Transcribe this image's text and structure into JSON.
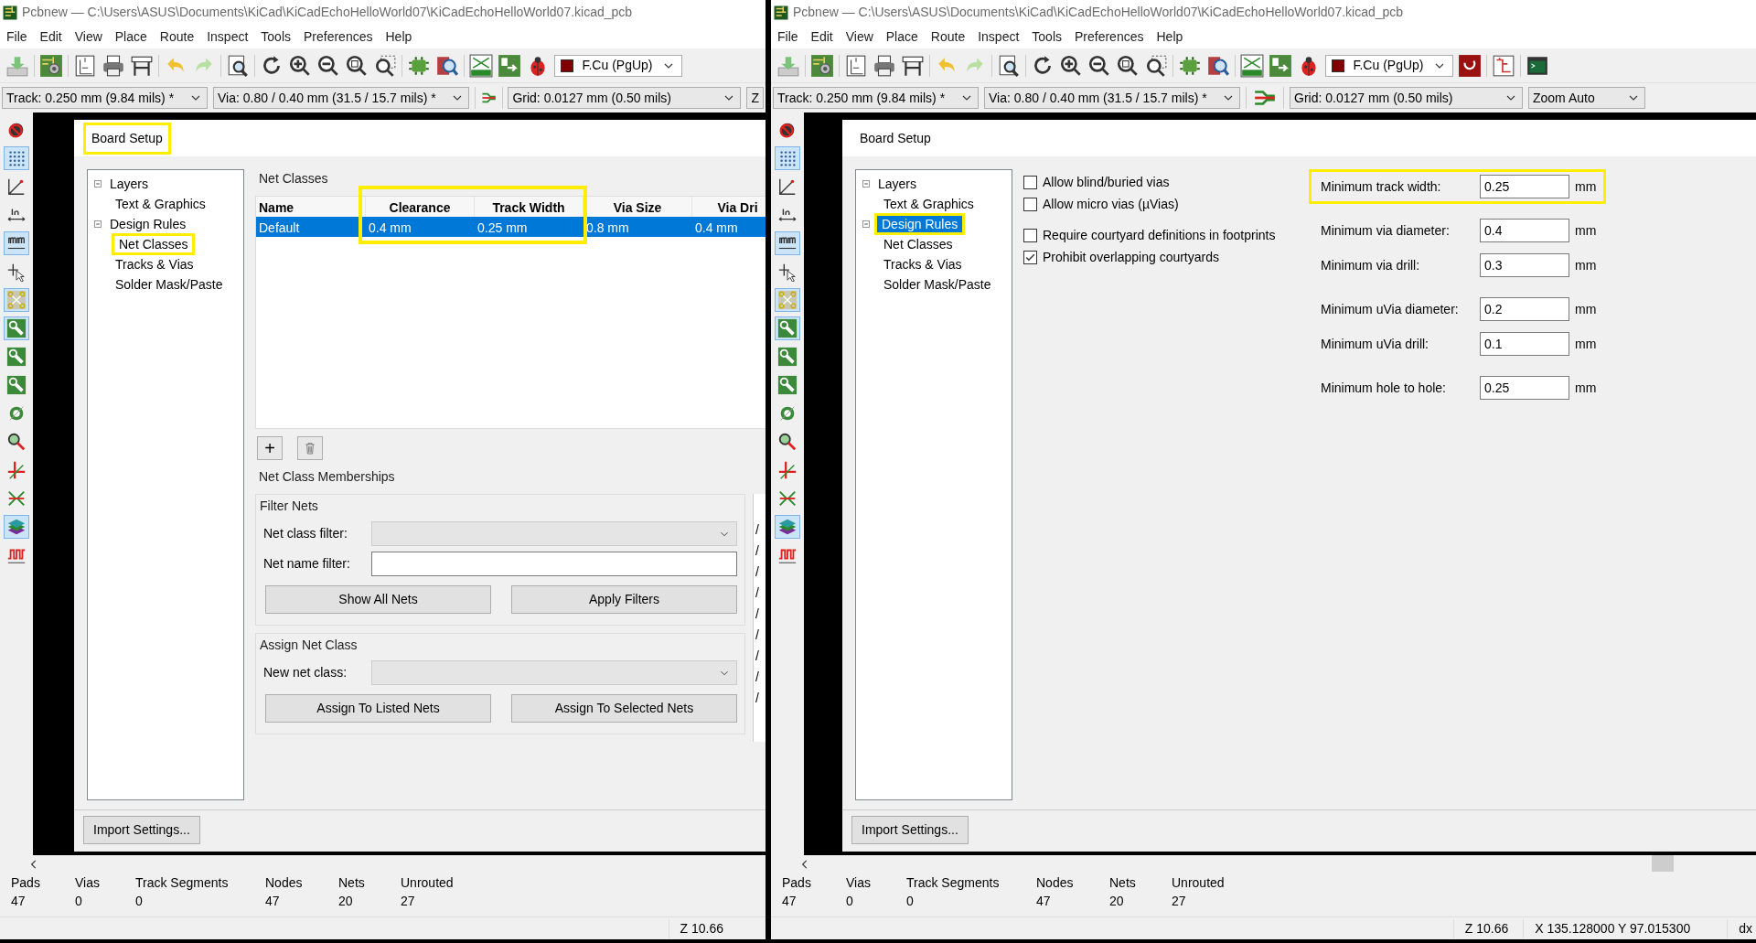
{
  "windows": [
    {
      "title": "Pcbnew — C:\\Users\\ASUS\\Documents\\KiCad\\KiCadEchoHelloWorld07\\KiCadEchoHelloWorld07.kicad_pcb",
      "menu": [
        "File",
        "Edit",
        "View",
        "Place",
        "Route",
        "Inspect",
        "Tools",
        "Preferences",
        "Help"
      ],
      "layer": "F.Cu (PgUp)",
      "extra_tools": false,
      "track": "Track: 0.250 mm (9.84 mils) *",
      "via": "Via: 0.80 / 0.40 mm (31.5 / 15.7 mils) *",
      "grid": "Grid: 0.0127 mm (0.50 mils)",
      "zoom": "Z",
      "side_tools": [
        {
          "kind": "drc",
          "active": false
        },
        {
          "kind": "grid",
          "active": true
        },
        {
          "kind": "polar",
          "active": false
        },
        {
          "kind": "inch",
          "active": false
        },
        {
          "kind": "mm",
          "active": true
        },
        {
          "kind": "cursor",
          "active": false
        },
        {
          "kind": "ratsnest",
          "active": true
        },
        {
          "kind": "track",
          "active": true
        },
        {
          "kind": "track",
          "active": false
        },
        {
          "kind": "track",
          "active": false
        },
        {
          "kind": "via",
          "active": false
        },
        {
          "kind": "highlight",
          "active": false
        },
        {
          "kind": "cross",
          "active": false
        },
        {
          "kind": "arrows",
          "active": false
        },
        {
          "kind": "layers",
          "active": true
        },
        {
          "kind": "wave",
          "active": false
        }
      ],
      "dialog": {
        "title": "Board Setup",
        "title_highlighted": true,
        "tree": [
          {
            "label": "Layers",
            "expanded": true,
            "selected": false,
            "highlighted": false,
            "children": [
              {
                "label": "Text & Graphics",
                "selected": false,
                "highlighted": false
              }
            ]
          },
          {
            "label": "Design Rules",
            "expanded": true,
            "selected": false,
            "highlighted": false,
            "children": [
              {
                "label": "Net Classes",
                "selected": false,
                "highlighted": true
              },
              {
                "label": "Tracks & Vias",
                "selected": false,
                "highlighted": false
              },
              {
                "label": "Solder Mask/Paste",
                "selected": false,
                "highlighted": false
              }
            ]
          }
        ],
        "panel": {
          "kind": "net_classes",
          "caption": "Net Classes",
          "table": {
            "columns": [
              {
                "label": "Name",
                "highlighted": false
              },
              {
                "label": "Clearance",
                "highlighted": true
              },
              {
                "label": "Track Width",
                "highlighted": true
              },
              {
                "label": "Via Size",
                "highlighted": false
              },
              {
                "label": "Via Dri",
                "highlighted": false
              }
            ],
            "rows": [
              {
                "cells": [
                  "Default",
                  "0.4 mm",
                  "0.25 mm",
                  "0.8 mm",
                  "0.4 mm"
                ],
                "selected": true
              }
            ]
          },
          "add_button": "+",
          "memberships": {
            "caption": "Net Class Memberships",
            "filter": {
              "caption": "Filter Nets",
              "class_label": "Net class filter:",
              "name_label": "Net name filter:",
              "buttons": [
                "Show All Nets",
                "Apply Filters"
              ]
            },
            "assign": {
              "caption": "Assign Net Class",
              "class_label": "New net class:",
              "buttons": [
                "Assign To Listed Nets",
                "Assign To Selected Nets"
              ]
            },
            "net_list": [
              "/",
              "/",
              "/",
              "/",
              "/",
              "/",
              "/",
              "/",
              "/"
            ]
          }
        },
        "import_button": "Import Settings..."
      },
      "stats": [
        {
          "label": "Pads",
          "value": "47"
        },
        {
          "label": "Vias",
          "value": "0"
        },
        {
          "label": "Track Segments",
          "value": "0"
        },
        {
          "label": "Nodes",
          "value": "47"
        },
        {
          "label": "Nets",
          "value": "20"
        },
        {
          "label": "Unrouted",
          "value": "27"
        }
      ],
      "status": [
        "Z 10.66"
      ]
    },
    {
      "title": "Pcbnew — C:\\Users\\ASUS\\Documents\\KiCad\\KiCadEchoHelloWorld07\\KiCadEchoHelloWorld07.kicad_pcb",
      "menu": [
        "File",
        "Edit",
        "View",
        "Place",
        "Route",
        "Inspect",
        "Tools",
        "Preferences",
        "Help"
      ],
      "layer": "F.Cu (PgUp)",
      "extra_tools": true,
      "track": "Track: 0.250 mm (9.84 mils) *",
      "via": "Via: 0.80 / 0.40 mm (31.5 / 15.7 mils) *",
      "grid": "Grid: 0.0127 mm (0.50 mils)",
      "zoom": "Zoom Auto",
      "side_tools": [
        {
          "kind": "drc",
          "active": false
        },
        {
          "kind": "grid",
          "active": true
        },
        {
          "kind": "polar",
          "active": false
        },
        {
          "kind": "inch",
          "active": false
        },
        {
          "kind": "mm",
          "active": true
        },
        {
          "kind": "cursor",
          "active": false
        },
        {
          "kind": "ratsnest",
          "active": true
        },
        {
          "kind": "track",
          "active": true
        },
        {
          "kind": "track",
          "active": false
        },
        {
          "kind": "track",
          "active": false
        },
        {
          "kind": "via",
          "active": false
        },
        {
          "kind": "highlight",
          "active": false
        },
        {
          "kind": "cross",
          "active": false
        },
        {
          "kind": "arrows",
          "active": false
        },
        {
          "kind": "layers",
          "active": true
        },
        {
          "kind": "wave",
          "active": false
        }
      ],
      "dialog": {
        "title": "Board Setup",
        "title_highlighted": false,
        "tree": [
          {
            "label": "Layers",
            "expanded": true,
            "selected": false,
            "highlighted": false,
            "children": [
              {
                "label": "Text & Graphics",
                "selected": false,
                "highlighted": false
              }
            ]
          },
          {
            "label": "Design Rules",
            "expanded": true,
            "selected": true,
            "highlighted": true,
            "children": [
              {
                "label": "Net Classes",
                "selected": false,
                "highlighted": false
              },
              {
                "label": "Tracks & Vias",
                "selected": false,
                "highlighted": false
              },
              {
                "label": "Solder Mask/Paste",
                "selected": false,
                "highlighted": false
              }
            ]
          }
        ],
        "panel": {
          "kind": "design_rules",
          "check_groups": [
            [
              {
                "label": "Allow blind/buried vias",
                "checked": false
              },
              {
                "label": "Allow micro vias (µVias)",
                "checked": false
              }
            ],
            [
              {
                "label": "Require courtyard definitions in footprints",
                "checked": false
              },
              {
                "label": "Prohibit overlapping courtyards",
                "checked": true
              }
            ]
          ],
          "field_groups": [
            [
              {
                "label": "Minimum track width:",
                "value": "0.25",
                "unit": "mm",
                "highlighted": true
              }
            ],
            [
              {
                "label": "Minimum via diameter:",
                "value": "0.4",
                "unit": "mm",
                "highlighted": false
              },
              {
                "label": "Minimum via drill:",
                "value": "0.3",
                "unit": "mm",
                "highlighted": false
              }
            ],
            [
              {
                "label": "Minimum uVia diameter:",
                "value": "0.2",
                "unit": "mm",
                "highlighted": false
              },
              {
                "label": "Minimum uVia drill:",
                "value": "0.1",
                "unit": "mm",
                "highlighted": false
              }
            ],
            [
              {
                "label": "Minimum hole to hole:",
                "value": "0.25",
                "unit": "mm",
                "highlighted": false
              }
            ]
          ]
        },
        "import_button": "Import Settings..."
      },
      "stats": [
        {
          "label": "Pads",
          "value": "47"
        },
        {
          "label": "Vias",
          "value": "0"
        },
        {
          "label": "Track Segments",
          "value": "0"
        },
        {
          "label": "Nodes",
          "value": "47"
        },
        {
          "label": "Nets",
          "value": "20"
        },
        {
          "label": "Unrouted",
          "value": "27"
        }
      ],
      "status": [
        "Z 10.66",
        "X 135.128000  Y 97.015300",
        "dx"
      ]
    }
  ]
}
